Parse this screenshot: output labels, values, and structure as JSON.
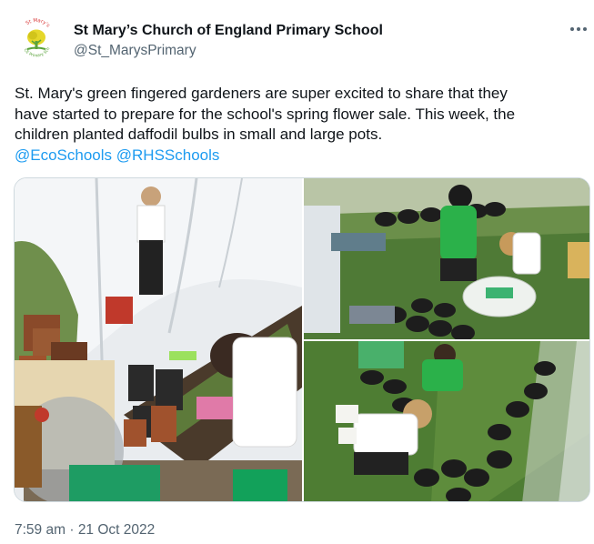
{
  "author": {
    "name": "St Mary’s Church of England Primary School",
    "handle": "@St_MarysPrimary",
    "avatar_icon": "school-tree-logo-icon",
    "avatar_logo_text_top": "St Mary's",
    "avatar_logo_text_bottom": "CE Primary School"
  },
  "tweet": {
    "text_lines": [
      "St. Mary's green fingered gardeners are super excited to share that they",
      "have started to prepare for the school's spring flower sale. This week, the",
      "children planted daffodil bulbs in small and large pots."
    ],
    "mentions": [
      "@EcoSchools",
      "@RHSSchools"
    ]
  },
  "media": {
    "photos": [
      {
        "description_icon": "polytunnel-photo"
      },
      {
        "description_icon": "children-planting-photo"
      },
      {
        "description_icon": "children-with-pots-photo"
      }
    ]
  },
  "meta": {
    "time": "7:59 am",
    "separator": "·",
    "date": "21 Oct 2022"
  },
  "colors": {
    "text": "#0f1419",
    "secondary": "#536471",
    "link": "#1d9bf0",
    "border": "#cfd9de"
  },
  "icons": {
    "more": "more-horizontal-icon"
  }
}
